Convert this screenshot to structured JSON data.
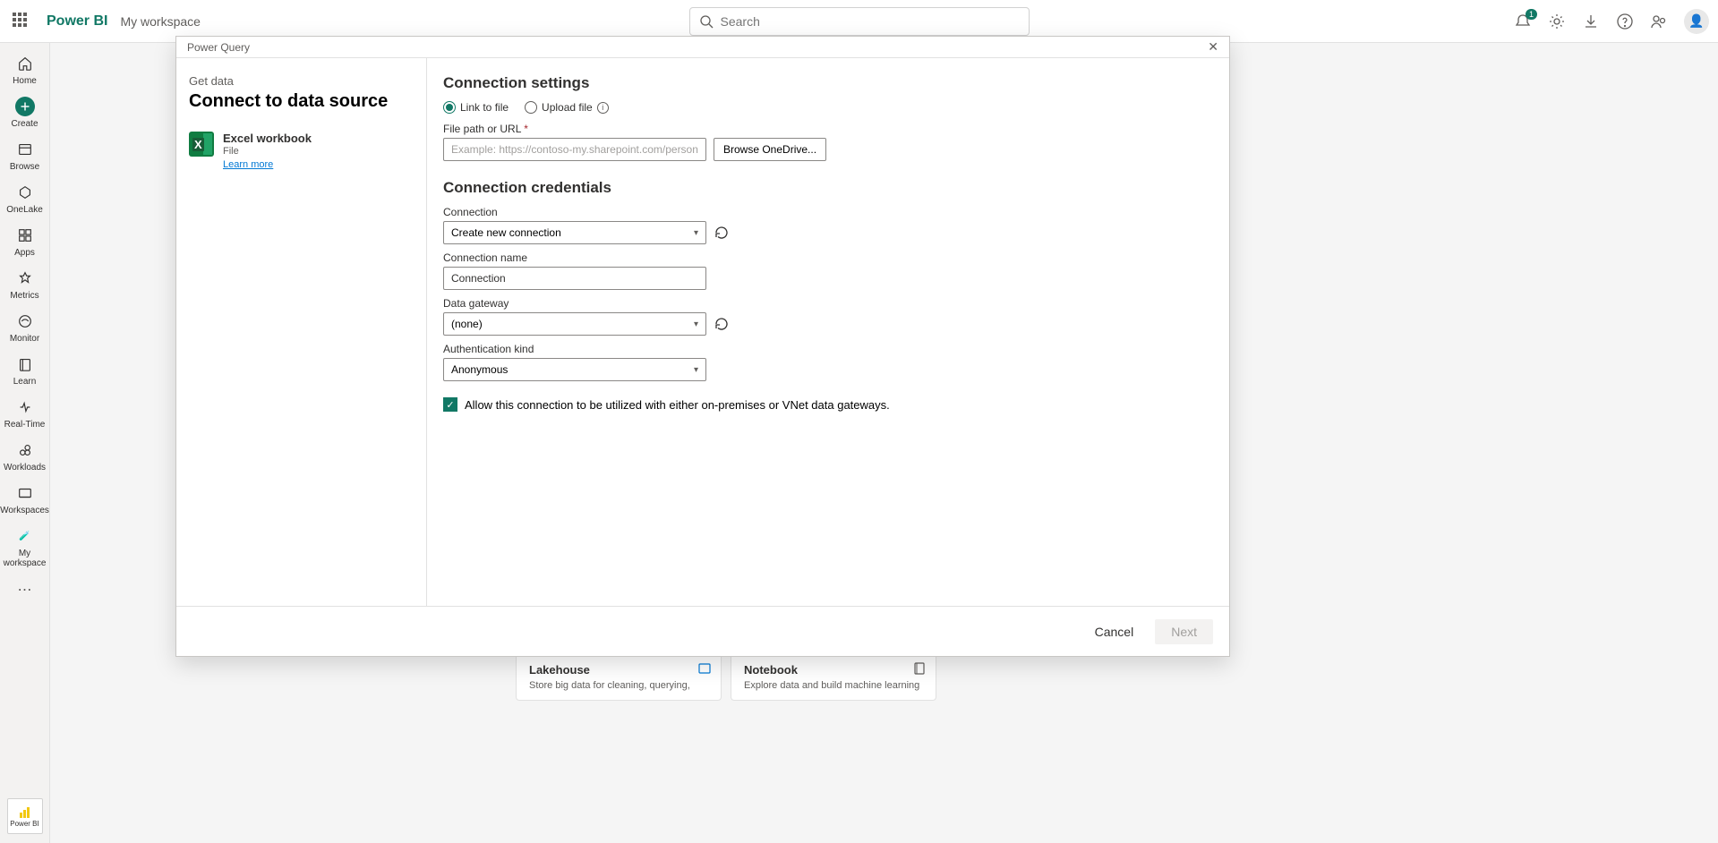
{
  "header": {
    "brand": "Power BI",
    "workspace": "My workspace",
    "search_placeholder": "Search",
    "notification_count": "1"
  },
  "nav": {
    "home": "Home",
    "create": "Create",
    "browse": "Browse",
    "onelake": "OneLake",
    "apps": "Apps",
    "metrics": "Metrics",
    "monitor": "Monitor",
    "learn": "Learn",
    "realtime": "Real-Time",
    "workloads": "Workloads",
    "workspaces": "Workspaces",
    "my_workspace": "My workspace",
    "pbi": "Power BI"
  },
  "dialog": {
    "title_bar": "Power Query",
    "breadcrumb": "Get data",
    "heading": "Connect to data source",
    "source": {
      "name": "Excel workbook",
      "type": "File",
      "learn_more": "Learn more"
    },
    "settings_h": "Connection settings",
    "radio_link": "Link to file",
    "radio_upload": "Upload file",
    "file_label": "File path or URL",
    "file_placeholder": "Example: https://contoso-my.sharepoint.com/personal/an...",
    "browse": "Browse OneDrive...",
    "creds_h": "Connection credentials",
    "connection_label": "Connection",
    "connection_value": "Create new connection",
    "conn_name_label": "Connection name",
    "conn_name_value": "Connection",
    "gateway_label": "Data gateway",
    "gateway_value": "(none)",
    "auth_label": "Authentication kind",
    "auth_value": "Anonymous",
    "allow_gateway": "Allow this connection to be utilized with either on-premises or VNet data gateways.",
    "cancel": "Cancel",
    "next": "Next"
  },
  "bg": {
    "lakehouse_t": "Lakehouse",
    "lakehouse_d": "Store big data for cleaning, querying,",
    "notebook_t": "Notebook",
    "notebook_d": "Explore data and build machine learning"
  }
}
